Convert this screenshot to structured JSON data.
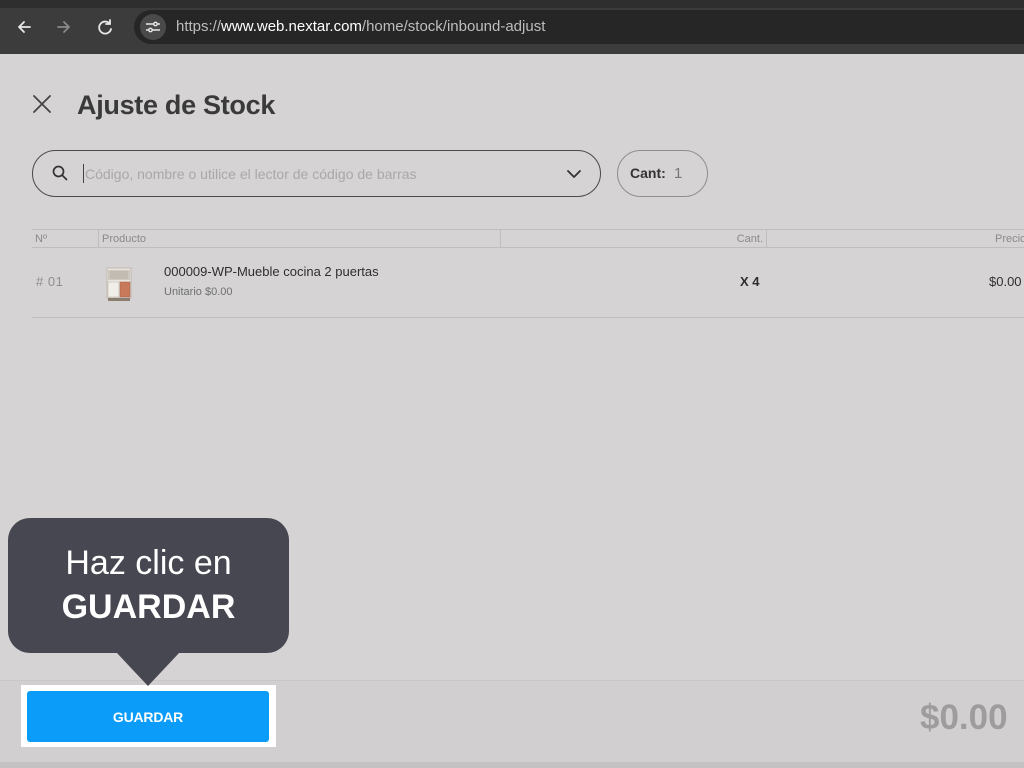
{
  "browser": {
    "url_prefix": "https://",
    "url_host": "www.web.nextar.com",
    "url_path": "/home/stock/inbound-adjust"
  },
  "page": {
    "title": "Ajuste de Stock"
  },
  "search": {
    "placeholder": "Código, nombre o utilice el lector de código de barras",
    "value": ""
  },
  "quantity": {
    "label": "Cant:",
    "value": "1"
  },
  "table": {
    "columns": [
      "Nº",
      "Producto",
      "Cant.",
      "Precio"
    ],
    "rows": [
      {
        "index": "# 01",
        "name": "000009-WP-Mueble cocina 2 puertas",
        "unit_price": "Unitario $0.00",
        "qty": "X 4",
        "price": "$0.00"
      }
    ]
  },
  "footer": {
    "save_label": "GUARDAR",
    "total": "$0.00"
  },
  "tooltip": {
    "line1": "Haz clic en",
    "line2": "GUARDAR"
  },
  "colors": {
    "accent": "#0b9cf9",
    "tooltip_bg": "#474751",
    "page_bg": "#d5d3d4"
  },
  "icons": [
    "back-arrow-icon",
    "forward-arrow-icon",
    "reload-icon",
    "site-settings-icon",
    "close-icon",
    "search-icon",
    "chevron-down-icon",
    "product-thumbnail"
  ]
}
